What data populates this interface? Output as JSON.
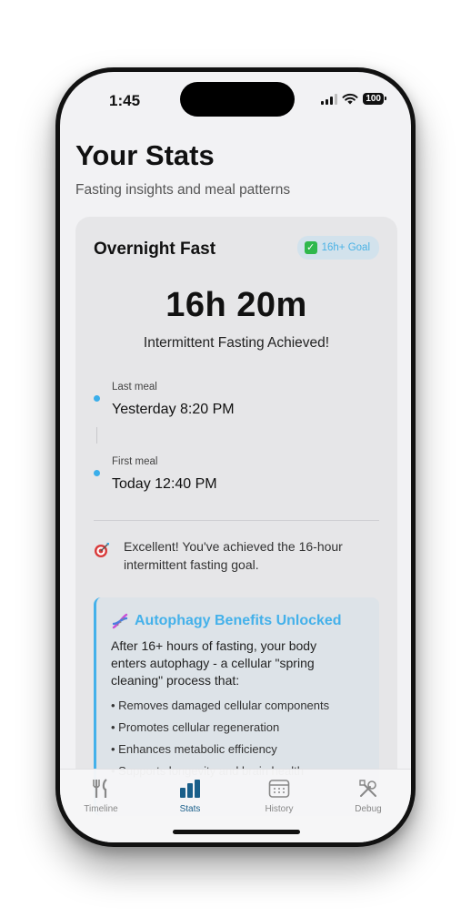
{
  "status_bar": {
    "time": "1:45",
    "battery": "100"
  },
  "header": {
    "title": "Your Stats",
    "subtitle": "Fasting insights and meal patterns"
  },
  "card": {
    "title": "Overnight Fast",
    "badge": "16h+ Goal",
    "duration": "16h 20m",
    "achievement": "Intermittent Fasting Achieved!",
    "last_meal": {
      "label": "Last meal",
      "value": "Yesterday 8:20 PM"
    },
    "first_meal": {
      "label": "First meal",
      "value": "Today 12:40 PM"
    },
    "message": "Excellent! You've achieved the 16-hour intermittent fasting goal."
  },
  "benefits": {
    "title": "Autophagy Benefits Unlocked",
    "description": "After 16+ hours of fasting, your body enters autophagy - a cellular \"spring cleaning\" process that:",
    "items": [
      "• Removes damaged cellular components",
      "• Promotes cellular regeneration",
      "• Enhances metabolic efficiency",
      "• Supports longevity and brain health"
    ]
  },
  "tabs": [
    {
      "label": "Timeline",
      "icon": "fork-knife-icon"
    },
    {
      "label": "Stats",
      "icon": "bar-chart-icon"
    },
    {
      "label": "History",
      "icon": "calendar-icon"
    },
    {
      "label": "Debug",
      "icon": "tools-icon"
    }
  ],
  "colors": {
    "accent": "#44b1ea",
    "active_tab": "#1a5f8a",
    "badge_bg": "#d2e2ec"
  }
}
